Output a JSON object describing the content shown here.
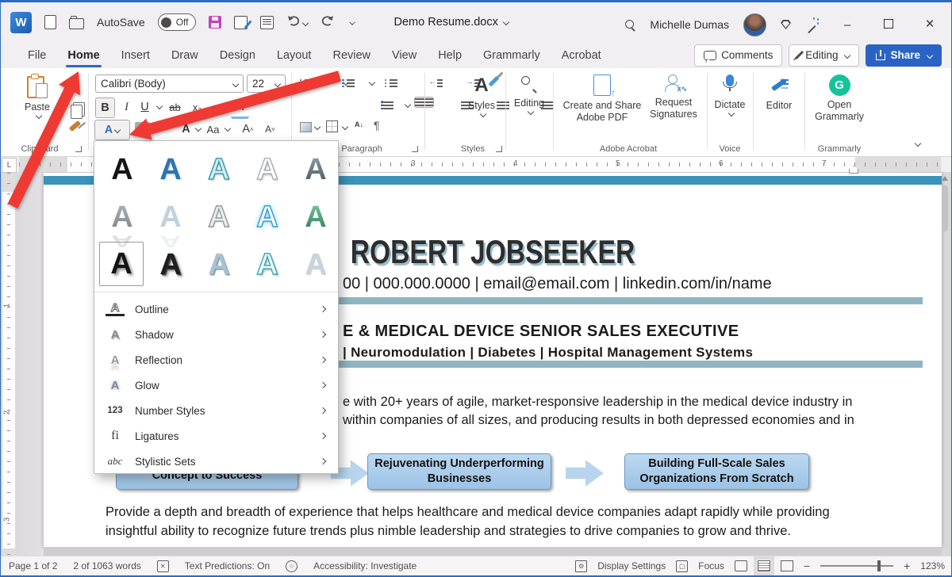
{
  "window": {
    "app_letter": "W",
    "autosave_label": "AutoSave",
    "autosave_state": "Off",
    "doc_title": "Demo Resume.docx",
    "user_name": "Michelle Dumas",
    "minimize": "–",
    "close": "×"
  },
  "tabs": [
    "File",
    "Home",
    "Insert",
    "Draw",
    "Design",
    "Layout",
    "Review",
    "View",
    "Help",
    "Grammarly",
    "Acrobat"
  ],
  "tab_actions": {
    "comments": "Comments",
    "editing": "Editing",
    "share": "Share"
  },
  "ribbon": {
    "clipboard": {
      "paste": "Paste",
      "group": "Clipboard"
    },
    "font": {
      "name": "Calibri (Body)",
      "size": "22",
      "bold": "B",
      "italic": "I",
      "underline": "U",
      "strikethrough": "ab",
      "subscript": "x₂",
      "superscript": "x²",
      "effects_letter": "A",
      "font_color_letter": "A",
      "case_label": "Aa",
      "grow": "A",
      "shrink": "A"
    },
    "paragraph": {
      "group": "Paragraph",
      "pilcrow": "¶",
      "sort": "A↓",
      "linespace": "↕"
    },
    "styles": {
      "button": "Styles",
      "group": "Styles",
      "icon_letter": "A"
    },
    "editing_btn": {
      "label": "Editing"
    },
    "acrobat": {
      "create": "Create and Share Adobe PDF",
      "request": "Request Signatures",
      "group": "Adobe Acrobat"
    },
    "voice": {
      "dictate": "Dictate",
      "group": "Voice"
    },
    "editor": {
      "label": "Editor"
    },
    "grammarly": {
      "open": "Open Grammarly",
      "group": "Grammarly",
      "icon_letter": "G"
    }
  },
  "dropdown": {
    "letter": "A",
    "menu": [
      {
        "label": "Outline",
        "icon": "A"
      },
      {
        "label": "Shadow",
        "icon": "A"
      },
      {
        "label": "Reflection",
        "icon": "A"
      },
      {
        "label": "Glow",
        "icon": "A"
      },
      {
        "label": "Number Styles",
        "icon": "123"
      },
      {
        "label": "Ligatures",
        "icon": "fi"
      },
      {
        "label": "Stylistic Sets",
        "icon": "abc"
      }
    ]
  },
  "ruler": {
    "h": [
      "3",
      "4",
      "5",
      "6",
      "7"
    ],
    "v": [
      "1",
      "2",
      "3"
    ],
    "tab_selector": "L"
  },
  "document": {
    "name": "ROBERT JOBSEEKER",
    "contact": "00 | 000.000.0000 | email@email.com | linkedin.com/in/name",
    "headline1": "E & MEDICAL DEVICE SENIOR SALES EXECUTIVE",
    "headline2": "| Neuromodulation | Diabetes | Hospital Management Systems",
    "para1_line1": "e with 20+ years of agile, market-responsive leadership in the medical device industry in",
    "para1_line2": "within companies of all sizes, and producing results in both depressed economies and in",
    "box1": "Concept to Success",
    "box2": "Rejuvenating Underperforming Businesses",
    "box3": "Building Full-Scale Sales Organizations From Scratch",
    "para2_line1": "Provide a depth and breadth of experience that helps healthcare and medical device companies adapt rapidly while providing",
    "para2_line2": "insightful ability to recognize future trends plus nimble leadership and strategies to drive companies to grow and thrive."
  },
  "statusbar": {
    "page": "Page 1 of 2",
    "words": "2 of 1063 words",
    "predictions": "Text Predictions: On",
    "accessibility": "Accessibility: Investigate",
    "display_settings": "Display Settings",
    "focus": "Focus",
    "zoom": "123%",
    "minus": "−",
    "plus": "+"
  },
  "icons": {
    "search": "magnifier",
    "premium": "gem",
    "assistant": "wand",
    "comments": "speech-bubble",
    "editing_mode": "pencil",
    "share": "box-up-arrow",
    "dictate": "microphone",
    "editor": "pen-lines",
    "grammarly": "green-circle-G",
    "save": "floppy",
    "undo": "arc-left",
    "redo": "arc-right"
  },
  "colors": {
    "accent_blue": "#2a6bc5",
    "share_blue": "#2a63c4",
    "teal_bar": "#3b93b9",
    "teal_bar_light": "#90b5c0",
    "box_fill": "#9cc2e5",
    "grammarly_green": "#15c39a",
    "save_purple": "#bd44bd",
    "arrow_red": "#ee3a33"
  }
}
